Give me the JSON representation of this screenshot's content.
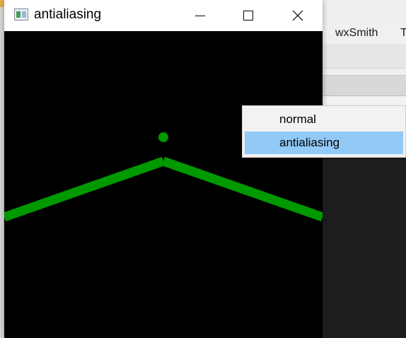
{
  "background_app": {
    "menu_items": [
      "wxSmith",
      "T"
    ]
  },
  "window": {
    "title": "antialiasing",
    "icon": "app-window-icon",
    "controls": {
      "minimize_icon": "minimize-icon",
      "maximize_icon": "maximize-icon",
      "close_icon": "close-icon"
    }
  },
  "canvas": {
    "background": "#000000",
    "stroke_color": "#009900"
  },
  "context_menu": {
    "items": [
      {
        "label": "normal",
        "highlighted": false
      },
      {
        "label": "antialiasing",
        "highlighted": true
      }
    ],
    "highlight_color": "#91c9f7"
  }
}
